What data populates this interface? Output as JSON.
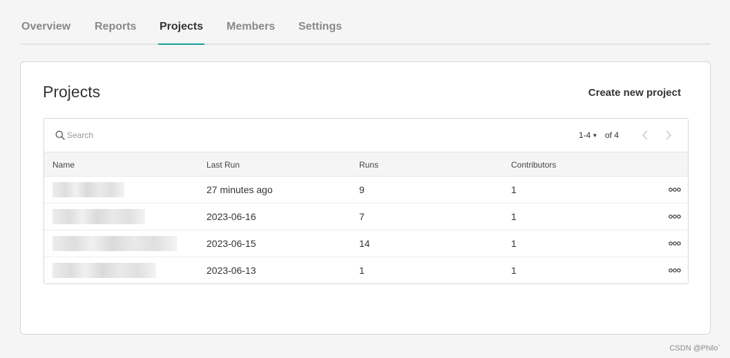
{
  "tabs": [
    {
      "label": "Overview",
      "active": false
    },
    {
      "label": "Reports",
      "active": false
    },
    {
      "label": "Projects",
      "active": true
    },
    {
      "label": "Members",
      "active": false
    },
    {
      "label": "Settings",
      "active": false
    }
  ],
  "accent_color": "#139c99",
  "card": {
    "title": "Projects",
    "create_label": "Create new project"
  },
  "search": {
    "placeholder": "Search",
    "value": ""
  },
  "pagination": {
    "range": "1-4",
    "total": "of 4"
  },
  "table": {
    "columns": [
      "Name",
      "Last Run",
      "Runs",
      "Contributors"
    ],
    "rows": [
      {
        "name_redacted": true,
        "last_run": "27 minutes ago",
        "runs": "9",
        "contributors": "1"
      },
      {
        "name_redacted": true,
        "last_run": "2023-06-16",
        "runs": "7",
        "contributors": "1"
      },
      {
        "name_redacted": true,
        "last_run": "2023-06-15",
        "runs": "14",
        "contributors": "1"
      },
      {
        "name_redacted": true,
        "last_run": "2023-06-13",
        "runs": "1",
        "contributors": "1"
      }
    ]
  },
  "icons": {
    "search": "search-icon",
    "prev": "chevron-left-icon",
    "next": "chevron-right-icon",
    "row_menu": "more-options-icon"
  },
  "watermark": "CSDN @Philo`"
}
